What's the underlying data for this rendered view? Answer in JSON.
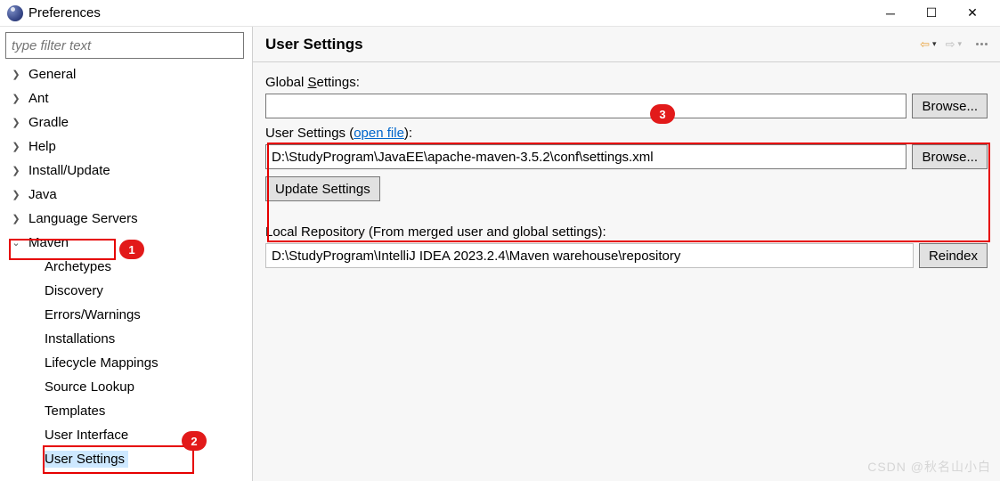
{
  "window": {
    "title": "Preferences"
  },
  "sidebar": {
    "filter_placeholder": "type filter text",
    "items": [
      {
        "label": "General",
        "expanded": false
      },
      {
        "label": "Ant",
        "expanded": false
      },
      {
        "label": "Gradle",
        "expanded": false
      },
      {
        "label": "Help",
        "expanded": false
      },
      {
        "label": "Install/Update",
        "expanded": false
      },
      {
        "label": "Java",
        "expanded": false
      },
      {
        "label": "Language Servers",
        "expanded": false
      },
      {
        "label": "Maven",
        "expanded": true,
        "children": [
          {
            "label": "Archetypes"
          },
          {
            "label": "Discovery"
          },
          {
            "label": "Errors/Warnings"
          },
          {
            "label": "Installations"
          },
          {
            "label": "Lifecycle Mappings"
          },
          {
            "label": "Source Lookup"
          },
          {
            "label": "Templates"
          },
          {
            "label": "User Interface"
          },
          {
            "label": "User Settings",
            "selected": true
          }
        ]
      }
    ]
  },
  "content": {
    "title": "User Settings",
    "global_settings_label": "Global Settings:",
    "global_settings_value": "",
    "browse_label": "Browse...",
    "user_settings_label_prefix": "User Settings (",
    "user_settings_open_file": "open file",
    "user_settings_label_suffix": "):",
    "user_settings_value": "D:\\StudyProgram\\JavaEE\\apache-maven-3.5.2\\conf\\settings.xml",
    "update_settings_label": "Update Settings",
    "local_repo_label": "Local Repository (From merged user and global settings):",
    "local_repo_value": "D:\\StudyProgram\\IntelliJ IDEA 2023.2.4\\Maven warehouse\\repository",
    "reindex_label": "Reindex"
  },
  "callouts": {
    "1": "1",
    "2": "2",
    "3": "3"
  },
  "watermark": "CSDN @秋名山小白"
}
